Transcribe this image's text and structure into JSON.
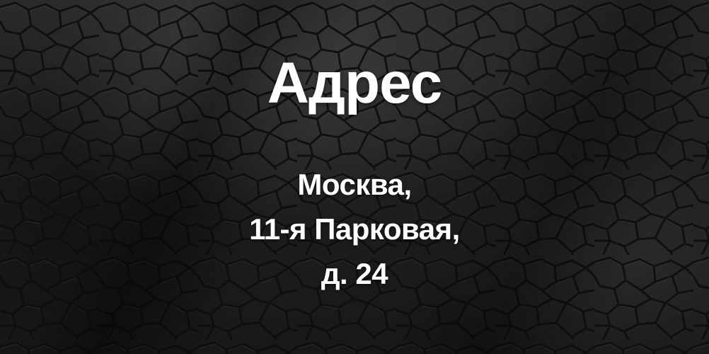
{
  "title": "Адрес",
  "address": {
    "line1": "Москва,",
    "line2": "11-я Парковая,",
    "line3": "д. 24"
  },
  "colors": {
    "background": "#1b1b1b",
    "text": "#ffffff",
    "cell_lines": "#0e0e0e"
  }
}
